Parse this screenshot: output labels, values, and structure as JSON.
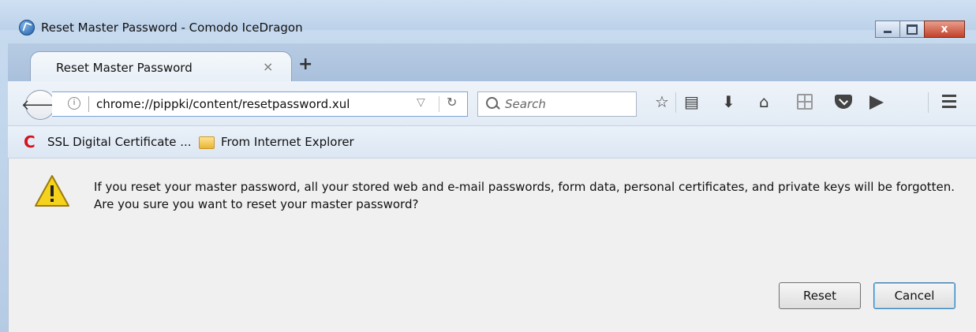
{
  "window": {
    "title": "Reset Master Password - Comodo IceDragon",
    "close_label": "x"
  },
  "tabs": [
    {
      "label": "Reset Master Password",
      "close_label": "×"
    }
  ],
  "new_tab_label": "+",
  "navbar": {
    "url": "chrome://pippki/content/resetpassword.xul",
    "search_placeholder": "Search"
  },
  "bookmarks": [
    {
      "label": "SSL Digital Certificate ...",
      "icon": "comodo-c-icon"
    },
    {
      "label": "From Internet Explorer",
      "icon": "folder-icon"
    }
  ],
  "dialog": {
    "message_line1": "If you reset your master password, all your stored web and e-mail passwords, form data, personal certificates, and private keys will be forgotten.",
    "message_line2": "Are you sure you want to reset your master password?",
    "reset_label": "Reset",
    "cancel_label": "Cancel"
  },
  "colors": {
    "accent": "#7aa3d8",
    "comodo_red": "#d4141c",
    "warning_yellow": "#f5d21b"
  }
}
